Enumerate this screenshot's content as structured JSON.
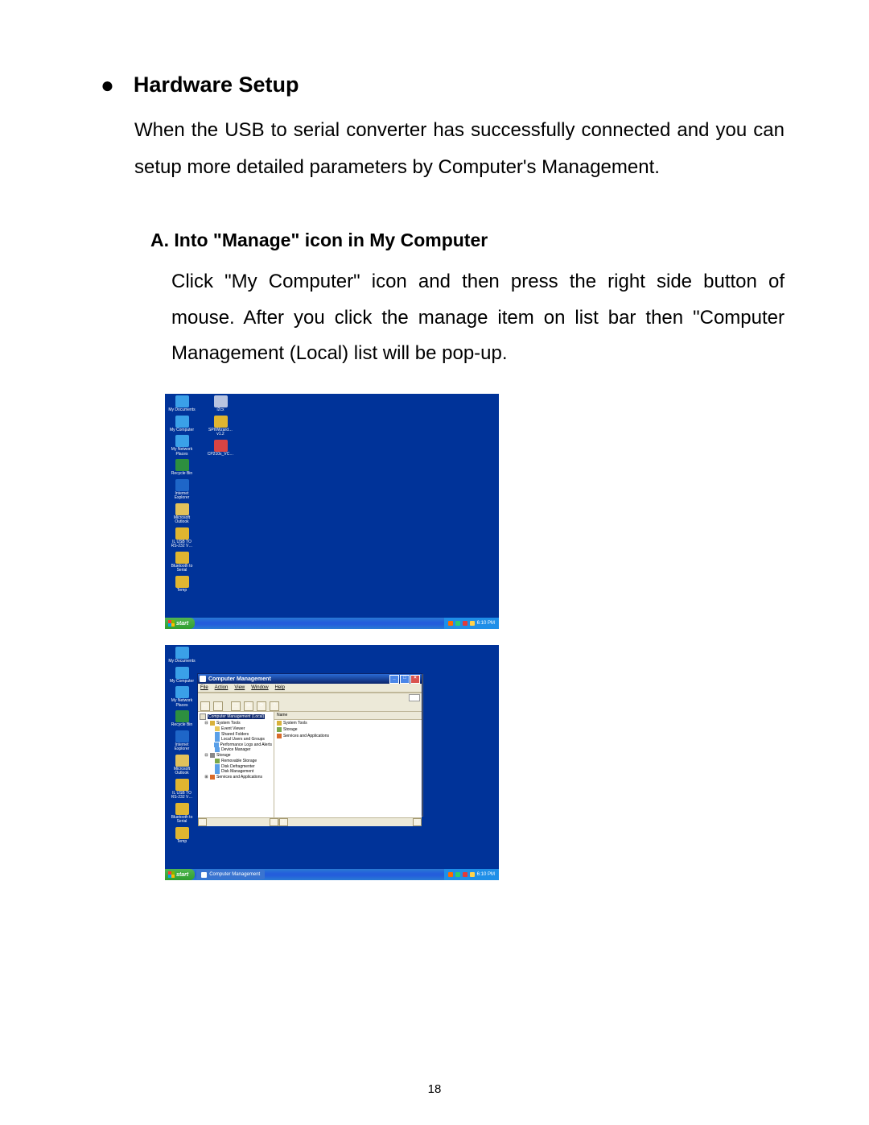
{
  "heading": "Hardware Setup",
  "intro": "When the USB to serial converter has successfully connected and you can setup more detailed parameters by Computer's Management.",
  "subheading": "A.  Into \"Manage\" icon in My Computer",
  "subpara": "Click \"My Computer\" icon and then press the right side button of mouse. After you click the manage item on list bar then \"Computer Management (Local) list will be pop-up.",
  "page_number": "18",
  "taskbar": {
    "start": "start",
    "task_item": "Computer Management",
    "clock": "6:10 PM"
  },
  "desktop": {
    "col1": [
      {
        "label": "My Documents",
        "color": "#3aa0e8"
      },
      {
        "label": "My Computer",
        "color": "#3aa0e8"
      },
      {
        "label": "My Network\nPlaces",
        "color": "#3aa0e8"
      },
      {
        "label": "Recycle Bin",
        "color": "#2d8f3f"
      },
      {
        "label": "Internet\nExplorer",
        "color": "#1e66c8"
      },
      {
        "label": "Microsoft\nOutlook",
        "color": "#e2c15a"
      },
      {
        "label": "IL USB TO\nRS-232 V…",
        "color": "#e0b530"
      },
      {
        "label": "Bluetooth to\nSerial",
        "color": "#e0b530"
      },
      {
        "label": "Temp",
        "color": "#e0b530"
      }
    ],
    "col2": [
      {
        "label": "i2cx",
        "color": "#b8c4e0"
      },
      {
        "label": "SPI/Wizard…\nv1.2",
        "color": "#e0b530"
      },
      {
        "label": "CP210x_VC…",
        "color": "#d94444"
      }
    ]
  },
  "cm": {
    "title": "Computer Management",
    "menu": [
      "File",
      "Action",
      "View",
      "Window",
      "Help"
    ],
    "tree_root": "Computer Management (Local)",
    "tree": [
      {
        "label": "System Tools",
        "children": [
          {
            "label": "Event Viewer"
          },
          {
            "label": "Shared Folders"
          },
          {
            "label": "Local Users and Groups"
          },
          {
            "label": "Performance Logs and Alerts"
          },
          {
            "label": "Device Manager"
          }
        ]
      },
      {
        "label": "Storage",
        "children": [
          {
            "label": "Removable Storage"
          },
          {
            "label": "Disk Defragmenter"
          },
          {
            "label": "Disk Management"
          }
        ]
      },
      {
        "label": "Services and Applications"
      }
    ],
    "list_header": "Name",
    "list_rows": [
      "System Tools",
      "Storage",
      "Services and Applications"
    ]
  }
}
